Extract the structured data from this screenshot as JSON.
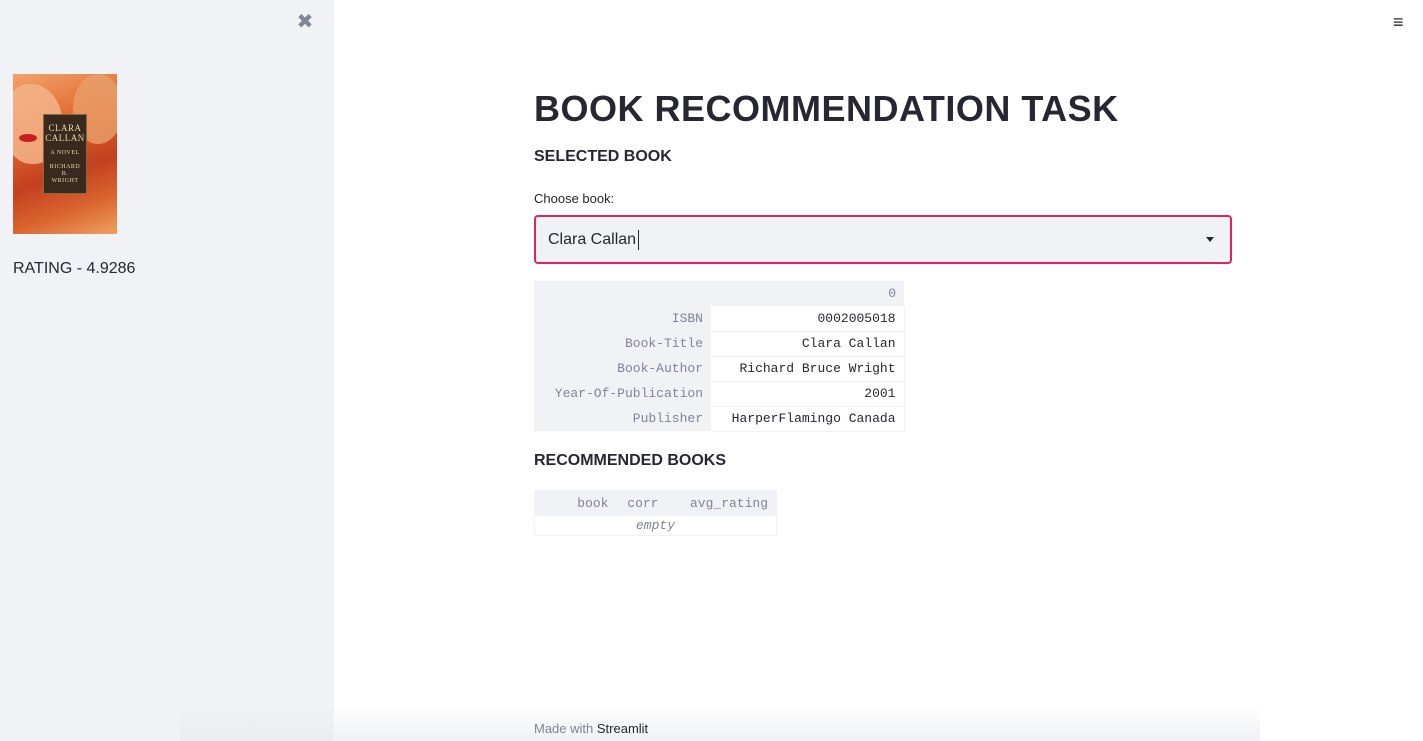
{
  "sidebar": {
    "close_glyph": "✖",
    "cover": {
      "title_line1": "CLARA",
      "title_line2": "CALLAN",
      "subtitle": "A NOVEL",
      "author_line1": "RICHARD B.",
      "author_line2": "WRIGHT"
    },
    "rating_text": "RATING - 4.9286"
  },
  "header": {
    "menu_glyph": "≡"
  },
  "main": {
    "title": "BOOK RECOMMENDATION TASK",
    "selected_heading": "SELECTED BOOK",
    "choose_label": "Choose book:",
    "select_value": "Clara Callan",
    "selected_table": {
      "column": "0",
      "rows": [
        {
          "index": "ISBN",
          "value": "0002005018"
        },
        {
          "index": "Book-Title",
          "value": "Clara Callan"
        },
        {
          "index": "Book-Author",
          "value": "Richard Bruce Wright"
        },
        {
          "index": "Year-Of-Publication",
          "value": "2001"
        },
        {
          "index": "Publisher",
          "value": "HarperFlamingo Canada"
        }
      ]
    },
    "recommended_heading": "RECOMMENDED BOOKS",
    "recommended_table": {
      "columns": [
        "book",
        "corr",
        "avg_rating"
      ],
      "empty_text": "empty"
    }
  },
  "footer": {
    "prefix": "Made with",
    "link": "Streamlit"
  }
}
